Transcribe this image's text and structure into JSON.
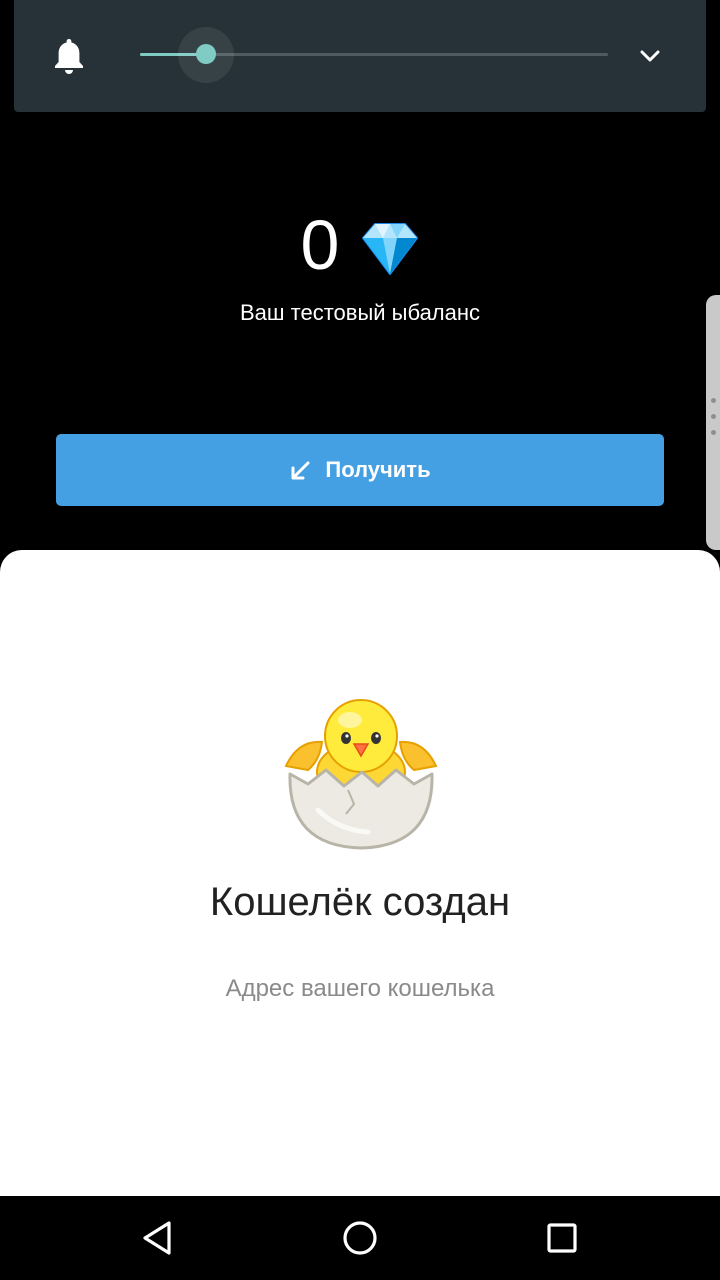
{
  "volume_panel": {
    "icon": "bell-icon",
    "level_percent": 14,
    "expand_icon": "chevron-down-icon",
    "accent_color": "#80cbc4"
  },
  "wallet": {
    "balance": "0",
    "currency_icon": "diamond-icon",
    "balance_label": "Ваш тестовый ыбаланс",
    "receive_button": {
      "label": "Получить",
      "icon": "arrow-down-left-icon",
      "color": "#459fe3"
    }
  },
  "sheet": {
    "illustration": "hatching-chick-icon",
    "title": "Кошелёк создан",
    "subtitle": "Адрес вашего кошелька"
  },
  "navbar": {
    "buttons": [
      "back-icon",
      "home-icon",
      "recents-icon"
    ]
  }
}
